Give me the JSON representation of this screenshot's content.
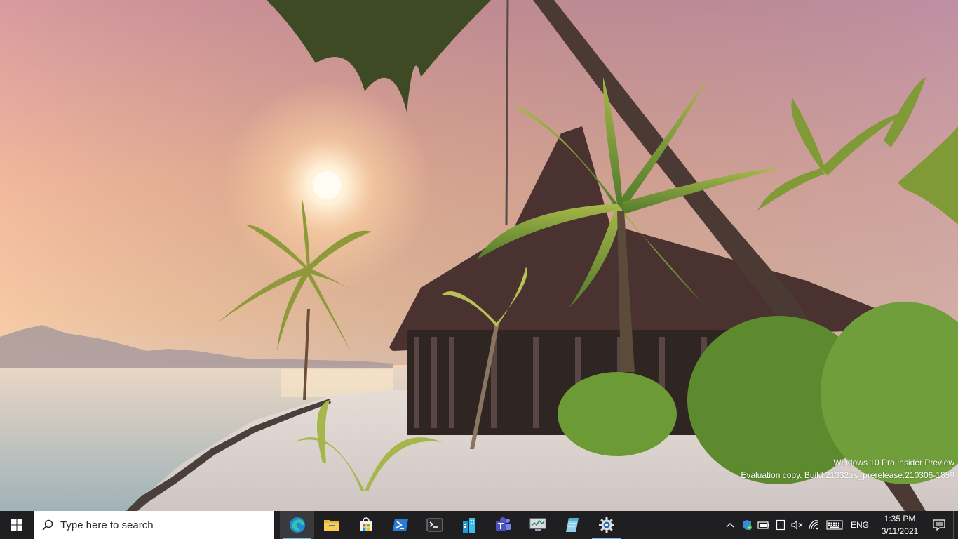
{
  "desktop": {
    "watermark_line1": "Windows 10 Pro Insider Preview",
    "watermark_line2": "Evaluation copy. Build 21332.rs_prerelease.210306-1859"
  },
  "taskbar": {
    "background": "#1f1f21",
    "search_placeholder": "Type here to search",
    "pinned": [
      {
        "name": "Microsoft Edge",
        "icon": "edge-icon",
        "running": true
      },
      {
        "name": "File Explorer",
        "icon": "folder-icon",
        "running": false
      },
      {
        "name": "Microsoft Store",
        "icon": "store-icon",
        "running": false
      },
      {
        "name": "PowerShell",
        "icon": "powershell-icon",
        "running": false
      },
      {
        "name": "Windows Terminal",
        "icon": "terminal-icon",
        "running": false
      },
      {
        "name": "Azure Data Studio",
        "icon": "building-icon",
        "running": false
      },
      {
        "name": "Microsoft Teams",
        "icon": "teams-icon",
        "running": false
      },
      {
        "name": "Resource Monitor",
        "icon": "monitor-icon",
        "running": false
      },
      {
        "name": "Notes",
        "icon": "notes-icon",
        "running": false
      },
      {
        "name": "Settings",
        "icon": "settings-icon",
        "running": true
      }
    ],
    "tray": {
      "language": "ENG",
      "time": "1:35 PM",
      "date": "3/11/2021"
    },
    "accent": "#76b9ed"
  }
}
